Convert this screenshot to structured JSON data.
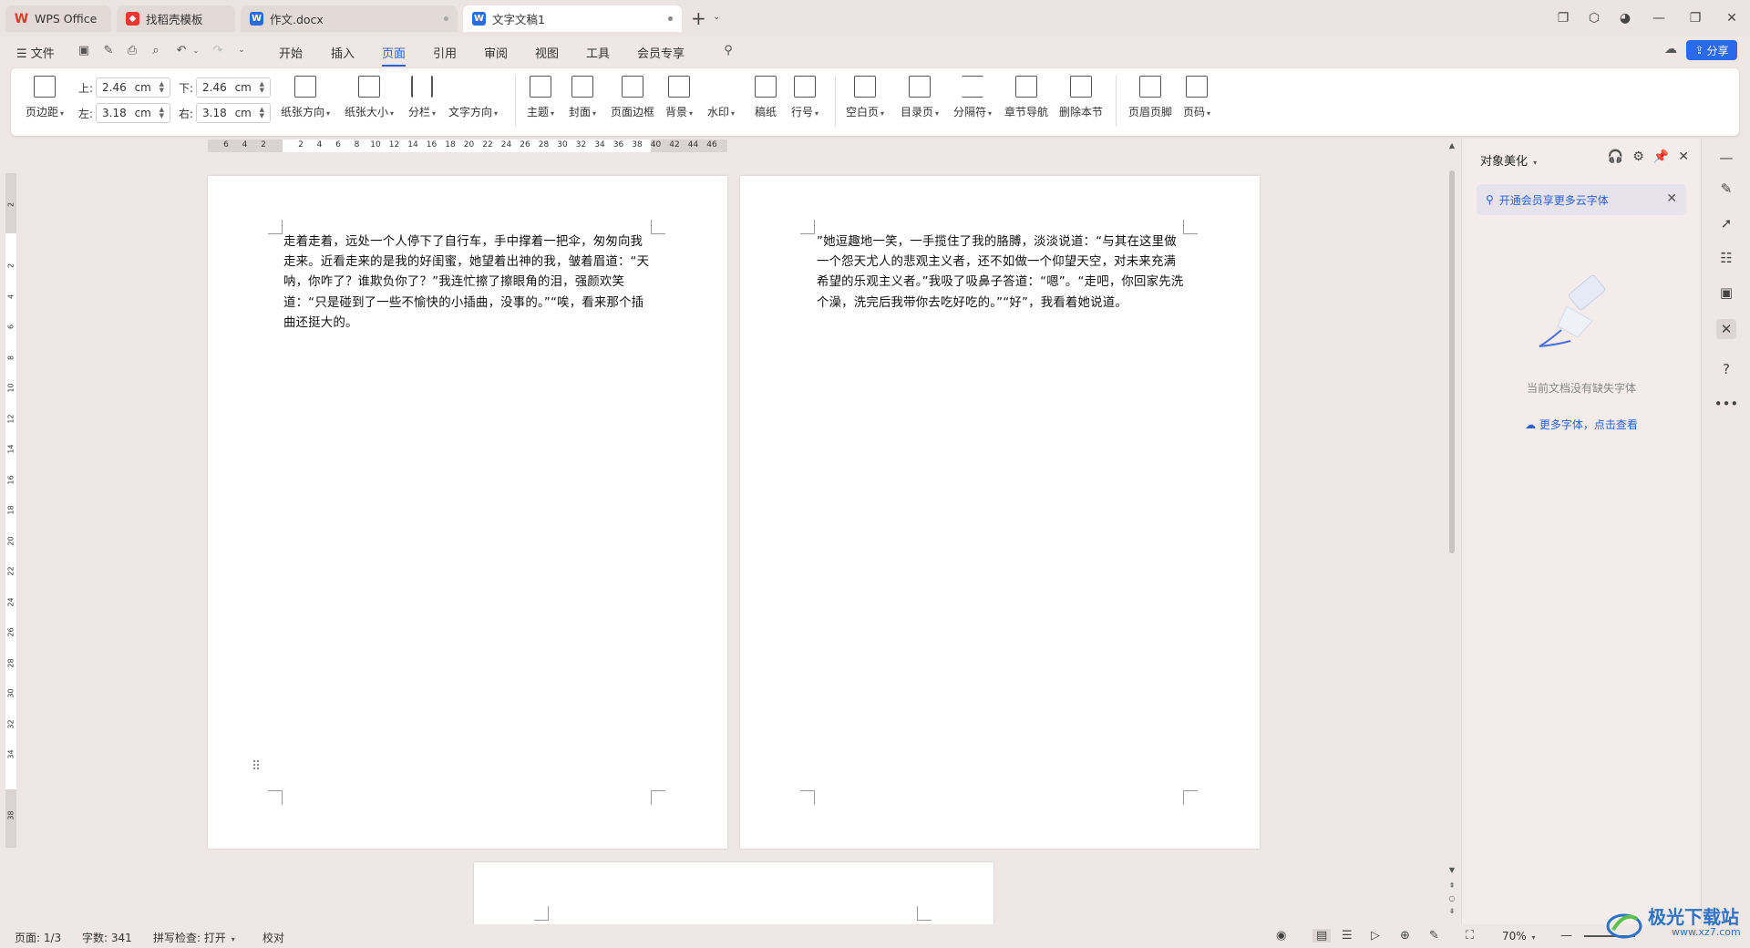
{
  "tabs": [
    {
      "label": "WPS Office",
      "color": "#e8372e"
    },
    {
      "label": "找稻壳模板",
      "color": "#e8372e"
    },
    {
      "label": "作文.docx",
      "color": "#2b6bdd"
    },
    {
      "label": "文字文稿1",
      "color": "#2b6bdd"
    }
  ],
  "menu": {
    "file": "文件",
    "items": [
      "开始",
      "插入",
      "页面",
      "引用",
      "审阅",
      "视图",
      "工具",
      "会员专享"
    ],
    "active": "页面",
    "share": "分享"
  },
  "ribbon": {
    "margins": "页边距",
    "top_label": "上:",
    "top_value": "2.46",
    "bottom_label": "下:",
    "bottom_value": "2.46",
    "left_label": "左:",
    "left_value": "3.18",
    "right_label": "右:",
    "right_value": "3.18",
    "unit": "cm",
    "orientation": "纸张方向",
    "size": "纸张大小",
    "columns": "分栏",
    "text_direction": "文字方向",
    "theme": "主题",
    "cover": "封面",
    "page_border": "页面边框",
    "background": "背景",
    "watermark": "水印",
    "draft_paper": "稿纸",
    "line_number": "行号",
    "blank_page": "空白页",
    "toc_page": "目录页",
    "separator": "分隔符",
    "section_nav": "章节导航",
    "delete_section": "删除本节",
    "header_footer": "页眉页脚",
    "page_number": "页码"
  },
  "hruler_ticks": [
    "6",
    "4",
    "2",
    "",
    "2",
    "4",
    "6",
    "8",
    "10",
    "12",
    "14",
    "16",
    "18",
    "20",
    "22",
    "24",
    "26",
    "28",
    "30",
    "32",
    "34",
    "36",
    "38",
    "40",
    "42",
    "44",
    "46"
  ],
  "vruler_ticks": [
    "2",
    "",
    "2",
    "4",
    "6",
    "8",
    "10",
    "12",
    "14",
    "16",
    "18",
    "20",
    "22",
    "24",
    "26",
    "28",
    "30",
    "32",
    "34",
    "",
    "38"
  ],
  "pages": {
    "page1": "走着走着，远处一个人停下了自行车，手中撑着一把伞，匆匆向我走来。近看走来的是我的好闺蜜，她望着出神的我，皱着眉道：“天呐，你咋了？谁欺负你了？”我连忙擦了擦眼角的泪，强颜欢笑道：“只是碰到了一些不愉快的小插曲，没事的。”“唉，看来那个插曲还挺大的。",
    "page2": "”她逗趣地一笑，一手揽住了我的胳膊，淡淡说道：“与其在这里做一个怨天尤人的悲观主义者，还不如做一个仰望天空，对未来充满希望的乐观主义者。”我吸了吸鼻子答道：“嗯”。“走吧，你回家先洗个澡，洗完后我带你去吃好吃的。”“好”，我看着她说道。"
  },
  "panel": {
    "title": "对象美化",
    "promo": "开通会员享更多云字体",
    "empty_msg": "当前文档没有缺失字体",
    "more_link": "更多字体，点击查看"
  },
  "status": {
    "page": "页面: 1/3",
    "words": "字数: 341",
    "spell": "拼写检查: 打开",
    "proof": "校对",
    "zoom": "70%"
  },
  "watermark": {
    "name": "极光下载站",
    "url": "www.xz7.com"
  },
  "colors": {
    "accent": "#2a5fd9",
    "share_bg": "#2a6ae8"
  }
}
